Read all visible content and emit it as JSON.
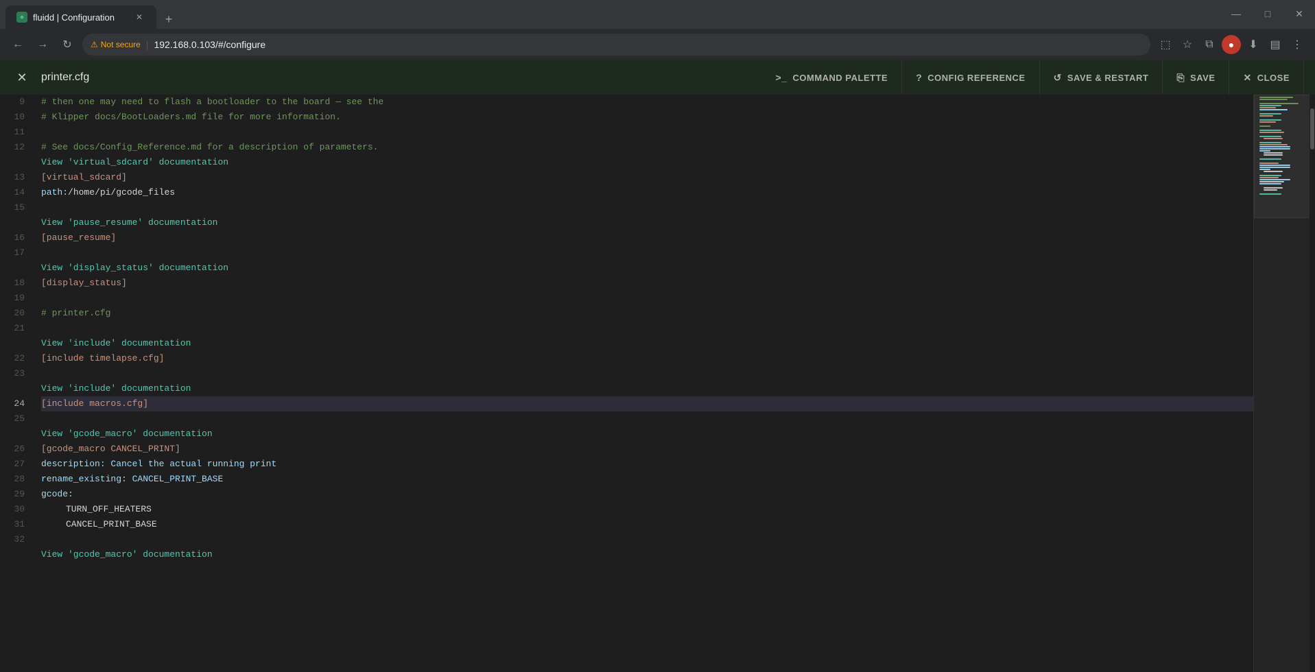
{
  "browser": {
    "tab_title": "fluidd | Configuration",
    "tab_favicon": "F",
    "address_bar_security": "Not secure",
    "address_bar_url": "192.168.0.103/#/configure",
    "window_controls": {
      "minimize": "—",
      "maximize": "□",
      "close": "✕"
    }
  },
  "app": {
    "close_icon": "✕",
    "file_title": "printer.cfg",
    "toolbar_buttons": [
      {
        "id": "command-palette",
        "icon": ">_",
        "label": "COMMAND PALETTE"
      },
      {
        "id": "config-reference",
        "icon": "?",
        "label": "CONFIG REFERENCE"
      },
      {
        "id": "save-restart",
        "icon": "↺",
        "label": "SAVE & RESTART"
      },
      {
        "id": "save",
        "icon": "□",
        "label": "SAVE"
      },
      {
        "id": "close",
        "icon": "✕",
        "label": "CLOSE"
      }
    ]
  },
  "editor": {
    "lines": [
      {
        "num": 9,
        "type": "comment",
        "text": "# then one may need to flash a bootloader to the board — see the"
      },
      {
        "num": 10,
        "type": "comment",
        "text": "# Klipper docs/BootLoaders.md file for more information."
      },
      {
        "num": 11,
        "type": "empty",
        "text": ""
      },
      {
        "num": 12,
        "type": "comment",
        "text": "# See docs/Config_Reference.md for a description of parameters."
      },
      {
        "num": 12,
        "type": "link",
        "text": "View 'virtual_sdcard' documentation"
      },
      {
        "num": 13,
        "type": "section",
        "text": "[virtual_sdcard]"
      },
      {
        "num": 14,
        "type": "keyval",
        "key": "path: ",
        "value": "/home/pi/gcode_files"
      },
      {
        "num": 15,
        "type": "empty",
        "text": ""
      },
      {
        "num": 15,
        "type": "link",
        "text": "View 'pause_resume' documentation"
      },
      {
        "num": 16,
        "type": "section",
        "text": "[pause_resume]"
      },
      {
        "num": 17,
        "type": "empty",
        "text": ""
      },
      {
        "num": 17,
        "type": "link",
        "text": "View 'display_status' documentation"
      },
      {
        "num": 18,
        "type": "section",
        "text": "[display_status]"
      },
      {
        "num": 19,
        "type": "empty",
        "text": ""
      },
      {
        "num": 20,
        "type": "comment",
        "text": "# printer.cfg"
      },
      {
        "num": 21,
        "type": "empty",
        "text": ""
      },
      {
        "num": 21,
        "type": "link",
        "text": "View 'include' documentation"
      },
      {
        "num": 22,
        "type": "section",
        "text": "[include timelapse.cfg]"
      },
      {
        "num": 23,
        "type": "empty",
        "text": ""
      },
      {
        "num": 23,
        "type": "link",
        "text": "View 'include' documentation"
      },
      {
        "num": 24,
        "type": "section",
        "text": "[include macros.cfg]",
        "active": true
      },
      {
        "num": 25,
        "type": "empty",
        "text": ""
      },
      {
        "num": 25,
        "type": "link",
        "text": "View 'gcode_macro' documentation"
      },
      {
        "num": 26,
        "type": "section",
        "text": "[gcode_macro CANCEL_PRINT]"
      },
      {
        "num": 27,
        "type": "keyval",
        "key": "description: ",
        "value": "Cancel the actual running print"
      },
      {
        "num": 28,
        "type": "keyval",
        "key": "rename_existing: ",
        "value": "CANCEL_PRINT_BASE"
      },
      {
        "num": 29,
        "type": "keyval",
        "key": "gcode:",
        "value": ""
      },
      {
        "num": 30,
        "type": "indented",
        "text": "TURN_OFF_HEATERS"
      },
      {
        "num": 31,
        "type": "indented",
        "text": "CANCEL_PRINT_BASE"
      },
      {
        "num": 32,
        "type": "empty",
        "text": ""
      },
      {
        "num": 32,
        "type": "link",
        "text": "View 'gcode_macro' documentation"
      }
    ]
  }
}
